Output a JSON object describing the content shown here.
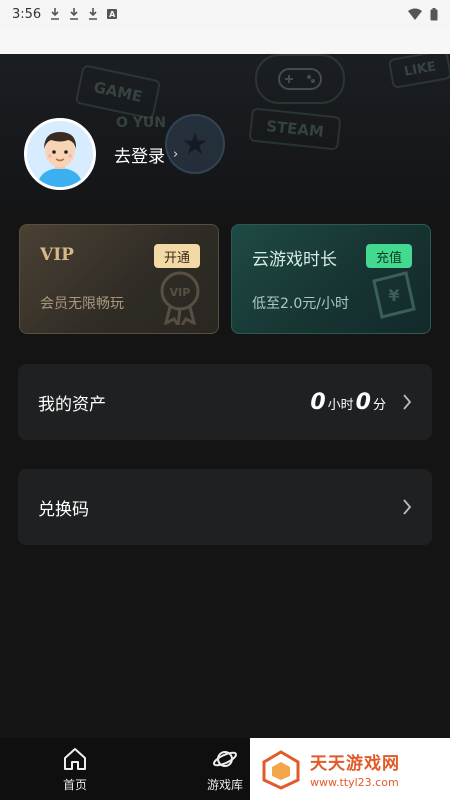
{
  "status_bar": {
    "time": "3:56"
  },
  "profile": {
    "login_label": "去登录"
  },
  "header_deco": {
    "game": "GAME",
    "steam": "STEAM",
    "like": "LIKE",
    "yun": "O YUN"
  },
  "vip_card": {
    "title": "VIP",
    "button": "开通",
    "subtitle": "会员无限畅玩"
  },
  "time_card": {
    "title": "云游戏时长",
    "button": "充值",
    "subtitle": "低至2.0元/小时"
  },
  "assets": {
    "label": "我的资产",
    "hours": "0",
    "hours_unit": "小时",
    "minutes": "0",
    "minutes_unit": "分"
  },
  "redeem": {
    "label": "兑换码"
  },
  "bottom_nav": {
    "items": [
      {
        "label": "首页",
        "icon": "home-icon"
      },
      {
        "label": "游戏库",
        "icon": "planet-icon"
      }
    ]
  },
  "watermark": {
    "title": "天天游戏网",
    "url": "www.ttyl23.com"
  },
  "colors": {
    "accent_green": "#43d98f",
    "vip_gold": "#f2d9a6",
    "watermark_orange": "#e25a2a"
  }
}
